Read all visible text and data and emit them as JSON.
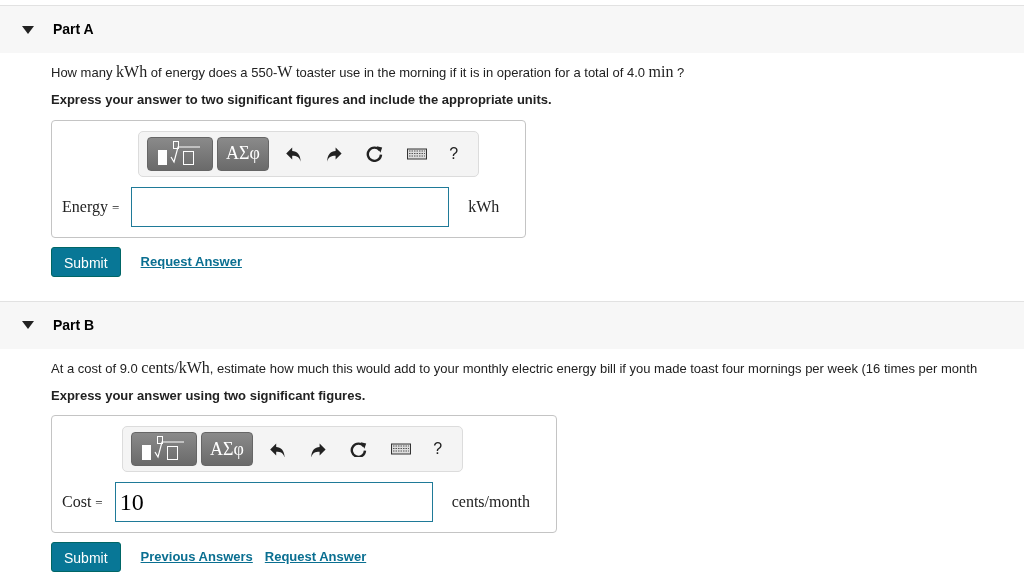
{
  "parts": [
    {
      "title": "Part A",
      "expanded": true,
      "question": [
        {
          "kind": "text",
          "text": "How many "
        },
        {
          "kind": "math",
          "text": "kWh"
        },
        {
          "kind": "text",
          "text": " of energy does a 550-"
        },
        {
          "kind": "math",
          "text": "W"
        },
        {
          "kind": "text",
          "text": " toaster use in the morning if it is in operation for a total of 4.0 "
        },
        {
          "kind": "math",
          "text": "min"
        },
        {
          "kind": "text",
          "text": " ?"
        }
      ],
      "instruction": "Express your answer to two significant figures and include the appropriate units.",
      "toolbar": {
        "greek": "ΑΣφ",
        "help": "?"
      },
      "label": "Energy =",
      "unit": "kWh",
      "submit": "Submit",
      "links": [
        "Request Answer"
      ]
    },
    {
      "title": "Part B",
      "expanded": true,
      "question": [
        {
          "kind": "text",
          "text": "At a cost of 9.0 "
        },
        {
          "kind": "math",
          "text": "cents/kWh"
        },
        {
          "kind": "text",
          "text": ", estimate how much this would add to your monthly electric energy bill if you made toast four mornings per week (16 times per month"
        }
      ],
      "instruction": "Express your answer using two significant figures.",
      "toolbar": {
        "greek": "ΑΣφ",
        "help": "?"
      },
      "label": "Cost =",
      "value": "10",
      "unit": "cents/month",
      "submit": "Submit",
      "links": [
        "Previous Answers",
        "Request Answer"
      ]
    }
  ]
}
